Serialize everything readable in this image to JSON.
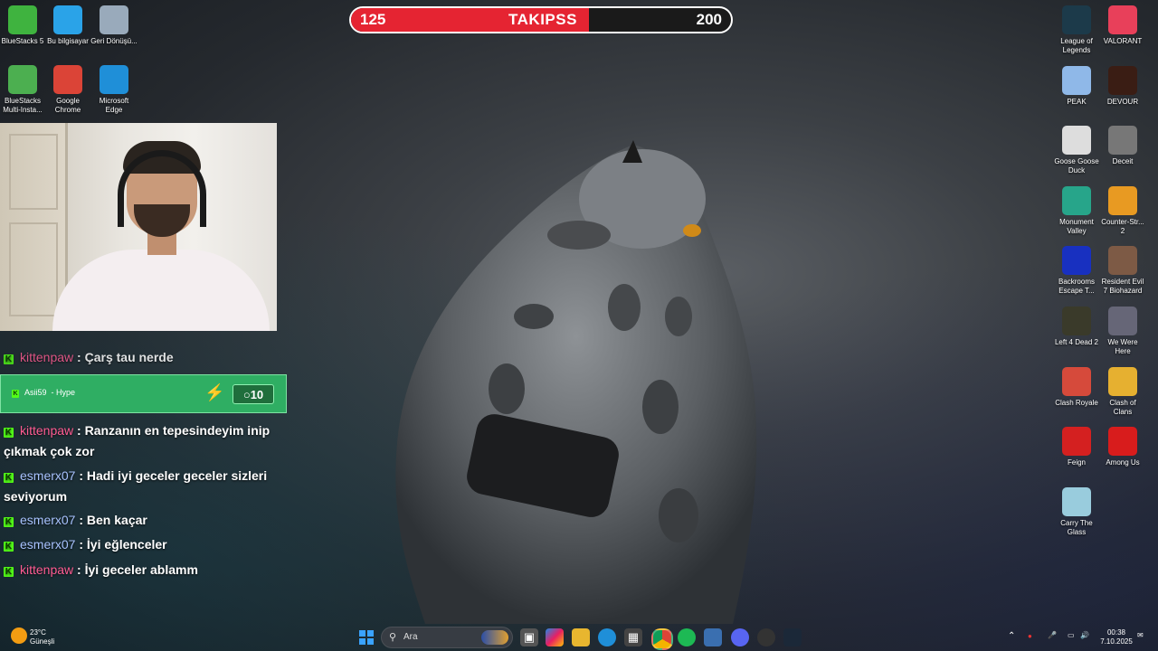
{
  "desktop_icons_left": [
    {
      "label": "BlueStacks 5",
      "icon": "bluestacks-icon",
      "color": "#3fb33f"
    },
    {
      "label": "Bu bilgisayar",
      "icon": "computer-icon",
      "color": "#2aa3e8"
    },
    {
      "label": "Geri Dönüşü...",
      "icon": "recycle-bin-icon",
      "color": "#9ab"
    },
    {
      "label": "BlueStacks Multi-Insta...",
      "icon": "bluestacks-multi-icon",
      "color": "#4caf50"
    },
    {
      "label": "Google Chrome",
      "icon": "chrome-icon",
      "color": "#db4437"
    },
    {
      "label": "Microsoft Edge",
      "icon": "edge-icon",
      "color": "#1f8fd8"
    }
  ],
  "desktop_icons_right": [
    {
      "label": "League of Legends",
      "icon": "league-of-legends-icon",
      "color": "#1c3a4a"
    },
    {
      "label": "VALORANT",
      "icon": "valorant-icon",
      "color": "#e8405a"
    },
    {
      "label": "PEAK",
      "icon": "peak-icon",
      "color": "#8fb8e8"
    },
    {
      "label": "DEVOUR",
      "icon": "devour-icon",
      "color": "#3a1d14"
    },
    {
      "label": "Goose Goose Duck",
      "icon": "goose-goose-duck-icon",
      "color": "#ddd"
    },
    {
      "label": "Deceit",
      "icon": "deceit-icon",
      "color": "#777"
    },
    {
      "label": "Monument Valley",
      "icon": "monument-valley-icon",
      "color": "#27a58a"
    },
    {
      "label": "Counter-Str... 2",
      "icon": "counter-strike-icon",
      "color": "#e89a22"
    },
    {
      "label": "Backrooms Escape T...",
      "icon": "backrooms-icon",
      "color": "#1830c0"
    },
    {
      "label": "Resident Evil 7 Biohazard",
      "icon": "resident-evil-icon",
      "color": "#7d5a45"
    },
    {
      "label": "Left 4 Dead 2",
      "icon": "left-4-dead-icon",
      "color": "#3a3a2a"
    },
    {
      "label": "We Were Here",
      "icon": "we-were-here-icon",
      "color": "#667"
    },
    {
      "label": "Clash Royale",
      "icon": "clash-royale-icon",
      "color": "#d64a3b"
    },
    {
      "label": "Clash of Clans",
      "icon": "clash-of-clans-icon",
      "color": "#e6b030"
    },
    {
      "label": "Feign",
      "icon": "feign-icon",
      "color": "#d42020"
    },
    {
      "label": "Among Us",
      "icon": "among-us-icon",
      "color": "#d81c1c"
    },
    {
      "label": "Carry The Glass",
      "icon": "carry-the-glass-icon",
      "color": "#9cd"
    }
  ],
  "goal_bar": {
    "current": "125",
    "title": "TAKIPSS",
    "target": "200",
    "progress": 0.625,
    "fill_color": "#e52432"
  },
  "chat": {
    "partial_top": {
      "user": "kittenpaw",
      "text": ": Çarş tau nerde"
    },
    "hype": {
      "user": "Asii59",
      "label": "- Hype",
      "amount": "10"
    },
    "messages": [
      {
        "user": "kittenpaw",
        "color": "pink",
        "text": ": Ranzanın en tepesindeyim inip çıkmak çok zor"
      },
      {
        "user": "esmerx07",
        "color": "blue",
        "text": ": Hadi iyi geceler geceler sizleri seviyorum"
      },
      {
        "user": "esmerx07",
        "color": "blue",
        "text": ": Ben kaçar"
      },
      {
        "user": "esmerx07",
        "color": "blue",
        "text": ": İyi eğlenceler"
      },
      {
        "user": "kittenpaw",
        "color": "pink",
        "text": ": İyi geceler ablamm"
      }
    ]
  },
  "taskbar": {
    "weather_temp": "23°C",
    "weather_desc": "Güneşli",
    "search_placeholder": "Ara",
    "time": "00:38",
    "date": "7.10.2025"
  }
}
